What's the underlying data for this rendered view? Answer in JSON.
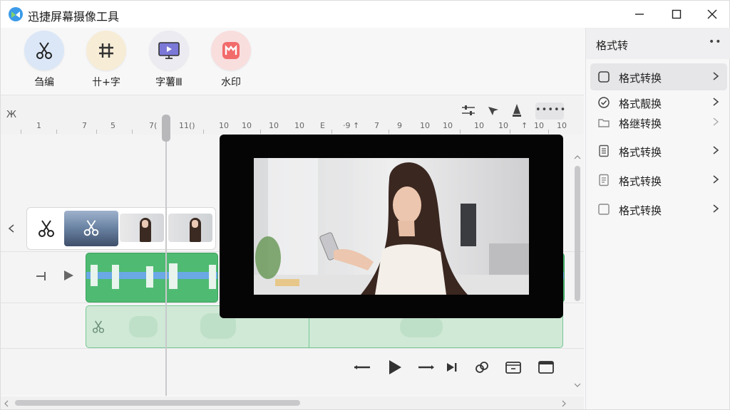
{
  "app": {
    "title": "迅捷屏幕摄像工具"
  },
  "toolbar": {
    "tools": [
      {
        "label": "刍编",
        "icon": "scissors-icon",
        "color": "#dbe7f7"
      },
      {
        "label": "卄+字",
        "icon": "text-add-icon",
        "color": "#f7ecd6"
      },
      {
        "label": "字薯Ⅲ",
        "icon": "monitor-icon",
        "color": "#ecebf1"
      },
      {
        "label": "水印",
        "icon": "watermark-icon",
        "color": "#f9dede"
      }
    ]
  },
  "ruler": {
    "left_icon": "Ж",
    "more": "•••••",
    "ticks": [
      "1",
      "7",
      "5",
      "7(",
      "11()",
      "10",
      "10",
      "10",
      "10",
      "E",
      "·9",
      "↑",
      "7",
      "9",
      "10",
      "10",
      "10",
      "10",
      "↑",
      "10",
      "10"
    ]
  },
  "right_panel": {
    "title": "格式转",
    "more": "••",
    "items": [
      {
        "label": "格式转换",
        "icon": "square-icon",
        "active": true
      },
      {
        "label": "格式靓换",
        "icon": "check-circle-icon",
        "active": false
      },
      {
        "label": "格继转换",
        "icon": "folder-icon",
        "active": false
      },
      {
        "label": "格式转换",
        "icon": "document-icon",
        "active": false
      },
      {
        "label": "格式转换",
        "icon": "document-lines-icon",
        "active": false
      },
      {
        "label": "格式转换",
        "icon": "square-icon",
        "active": false
      }
    ]
  },
  "colors": {
    "clip_green": "#4fbb72",
    "clip_light": "#cfe9d6",
    "strip_blue": "#6aa8e6",
    "accent_red": "#f26b6b"
  }
}
